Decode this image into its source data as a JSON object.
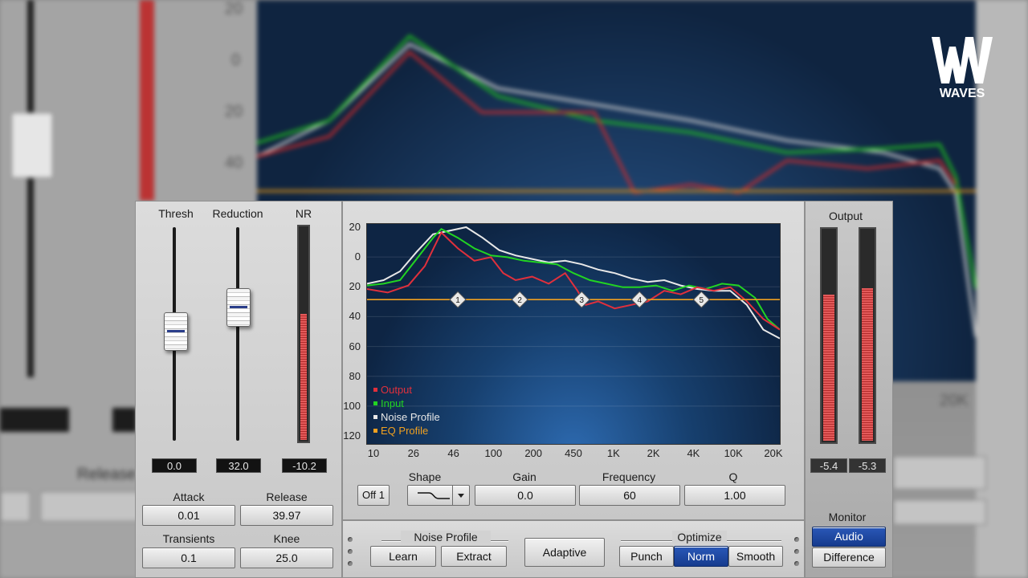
{
  "brand": {
    "logo_text": "WAVES"
  },
  "background": {
    "release_label": "Release",
    "freq_tick_20k": "20K",
    "y_ticks": [
      "20",
      "0",
      "20",
      "40"
    ]
  },
  "dynamics": {
    "thresh_label": "Thresh",
    "reduction_label": "Reduction",
    "nr_label": "NR",
    "thresh_value": "0.0",
    "reduction_value": "32.0",
    "nr_value": "-10.2",
    "nr_level": 0.6
  },
  "envelope": {
    "attack_label": "Attack",
    "attack_value": "0.01",
    "release_label": "Release",
    "release_value": "39.97",
    "transients_label": "Transients",
    "transients_value": "0.1",
    "knee_label": "Knee",
    "knee_value": "25.0"
  },
  "chart_data": {
    "type": "line",
    "y_ticks": [
      "20",
      "0",
      "20",
      "40",
      "60",
      "80",
      "100",
      "120"
    ],
    "x_ticks": [
      "10",
      "26",
      "46",
      "100",
      "200",
      "450",
      "1K",
      "2K",
      "4K",
      "10K",
      "20K"
    ],
    "legend": [
      {
        "name": "Output",
        "color": "#e0303c"
      },
      {
        "name": "Input",
        "color": "#22d422"
      },
      {
        "name": "Noise Profile",
        "color": "#e8e8e8"
      },
      {
        "name": "EQ Profile",
        "color": "#f0a020"
      }
    ],
    "eq_band_labels": [
      "1",
      "2",
      "3",
      "4",
      "5"
    ],
    "series": [
      {
        "name": "Noise Profile",
        "points": [
          [
            0,
            32
          ],
          [
            4,
            30
          ],
          [
            8,
            25
          ],
          [
            12,
            14
          ],
          [
            16,
            4
          ],
          [
            20,
            2
          ],
          [
            24,
            0
          ],
          [
            28,
            6
          ],
          [
            32,
            13
          ],
          [
            36,
            16
          ],
          [
            40,
            18
          ],
          [
            44,
            20
          ],
          [
            48,
            19
          ],
          [
            52,
            21
          ],
          [
            56,
            24
          ],
          [
            60,
            26
          ],
          [
            64,
            29
          ],
          [
            68,
            31
          ],
          [
            72,
            30
          ],
          [
            76,
            33
          ],
          [
            80,
            35
          ],
          [
            84,
            36
          ],
          [
            88,
            36
          ],
          [
            92,
            44
          ],
          [
            96,
            58
          ],
          [
            100,
            63
          ]
        ]
      },
      {
        "name": "Input",
        "points": [
          [
            0,
            33
          ],
          [
            4,
            32
          ],
          [
            8,
            30
          ],
          [
            12,
            18
          ],
          [
            16,
            6
          ],
          [
            18,
            1
          ],
          [
            22,
            6
          ],
          [
            26,
            12
          ],
          [
            30,
            16
          ],
          [
            34,
            17
          ],
          [
            38,
            19
          ],
          [
            42,
            20
          ],
          [
            46,
            21
          ],
          [
            50,
            26
          ],
          [
            54,
            30
          ],
          [
            58,
            32
          ],
          [
            62,
            34
          ],
          [
            66,
            34
          ],
          [
            70,
            33
          ],
          [
            74,
            36
          ],
          [
            78,
            33
          ],
          [
            82,
            35
          ],
          [
            86,
            32
          ],
          [
            90,
            33
          ],
          [
            94,
            40
          ],
          [
            97,
            52
          ],
          [
            100,
            58
          ]
        ]
      },
      {
        "name": "Output",
        "points": [
          [
            0,
            35
          ],
          [
            5,
            37
          ],
          [
            10,
            33
          ],
          [
            14,
            22
          ],
          [
            18,
            3
          ],
          [
            22,
            12
          ],
          [
            26,
            19
          ],
          [
            30,
            17
          ],
          [
            33,
            26
          ],
          [
            36,
            30
          ],
          [
            40,
            28
          ],
          [
            44,
            32
          ],
          [
            48,
            26
          ],
          [
            51,
            36
          ],
          [
            53,
            44
          ],
          [
            56,
            42
          ],
          [
            60,
            46
          ],
          [
            64,
            44
          ],
          [
            68,
            42
          ],
          [
            72,
            36
          ],
          [
            76,
            38
          ],
          [
            80,
            34
          ],
          [
            84,
            36
          ],
          [
            88,
            34
          ],
          [
            92,
            42
          ],
          [
            96,
            52
          ],
          [
            100,
            58
          ]
        ]
      },
      {
        "name": "EQ Profile",
        "points": [
          [
            0,
            41
          ],
          [
            100,
            41
          ]
        ]
      }
    ]
  },
  "controls": {
    "shape_label": "Shape",
    "gain_label": "Gain",
    "frequency_label": "Frequency",
    "q_label": "Q",
    "band_button": "Off 1",
    "gain_value": "0.0",
    "frequency_value": "60",
    "q_value": "1.00"
  },
  "output": {
    "label": "Output",
    "left_value": "-5.4",
    "right_value": "-5.3",
    "left_level": 0.7,
    "right_level": 0.73
  },
  "bottom": {
    "noise_profile_label": "Noise Profile",
    "learn": "Learn",
    "extract": "Extract",
    "adaptive": "Adaptive",
    "optimize_label": "Optimize",
    "punch": "Punch",
    "norm": "Norm",
    "smooth": "Smooth",
    "monitor_label": "Monitor",
    "audio": "Audio",
    "difference": "Difference"
  }
}
